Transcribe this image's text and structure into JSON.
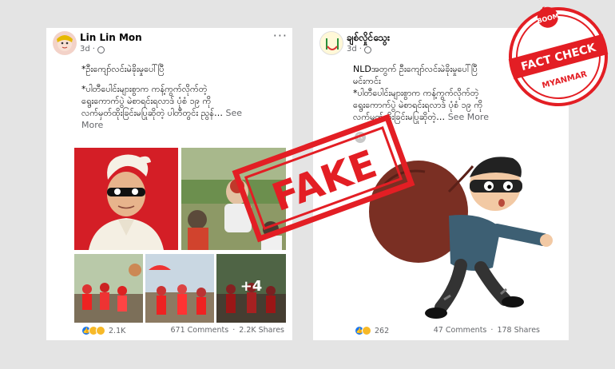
{
  "left_post": {
    "author": "Lin Lin Mon",
    "time": "3d",
    "more": "···",
    "text_line1": "*ဦးကျော်လင်းမဲခိုးမှုပေါ်ပြီ",
    "text_line2": "*ပါတီပေါင်းများစွာက ကန့်ကွက်လိုက်တဲ့",
    "text_line3": "ရွေးကောက်ပွဲ မဲစာရင်းရလာဒ် ပုံစံ ၁၉ ကို",
    "text_line4": "လက်မှတ်ထိုးခြင်းမပြုဆိုတဲ့ ပါတီတွင်း ညွန်…",
    "see_more": "See",
    "see_more2": "More",
    "reaction_count": "2.1K",
    "comments": "671 Comments",
    "shares": "2.2K Shares",
    "extra_photos": "+4"
  },
  "right_post": {
    "author": "ချစ်လှိုင်သွေး",
    "time": "3d",
    "text_line1": "NLDအတွက် ဦးကျော်လင်းမဲခိုးမှုပေါ်ပြီ",
    "text_line2": "မင်းကင်း",
    "text_line3": "*ပါတီပေါင်းများစွာက ကန့်ကွက်လိုက်တဲ့",
    "text_line4": "ရွေးကောက်ပွဲ မဲစာရင်းရလာဒ် ပုံစံ ၁၉ ကို",
    "text_line5": "လက်မှတ်ထိုးခြင်းမပြုဆိုတဲ့…",
    "see_more": "See More",
    "reaction_count": "262",
    "comments": "47 Comments",
    "shares": "178 Shares"
  },
  "stamp": {
    "text": "FAKE",
    "color": "#e31e24"
  },
  "badge": {
    "top": "BOOM",
    "middle": "FACT CHECK",
    "bottom": "MYANMAR",
    "color": "#e31e24"
  },
  "icons": [
    "avatar",
    "globe-icon",
    "more-options-icon",
    "like-reaction-icon",
    "wow-reaction-icon",
    "thief-cartoon"
  ]
}
